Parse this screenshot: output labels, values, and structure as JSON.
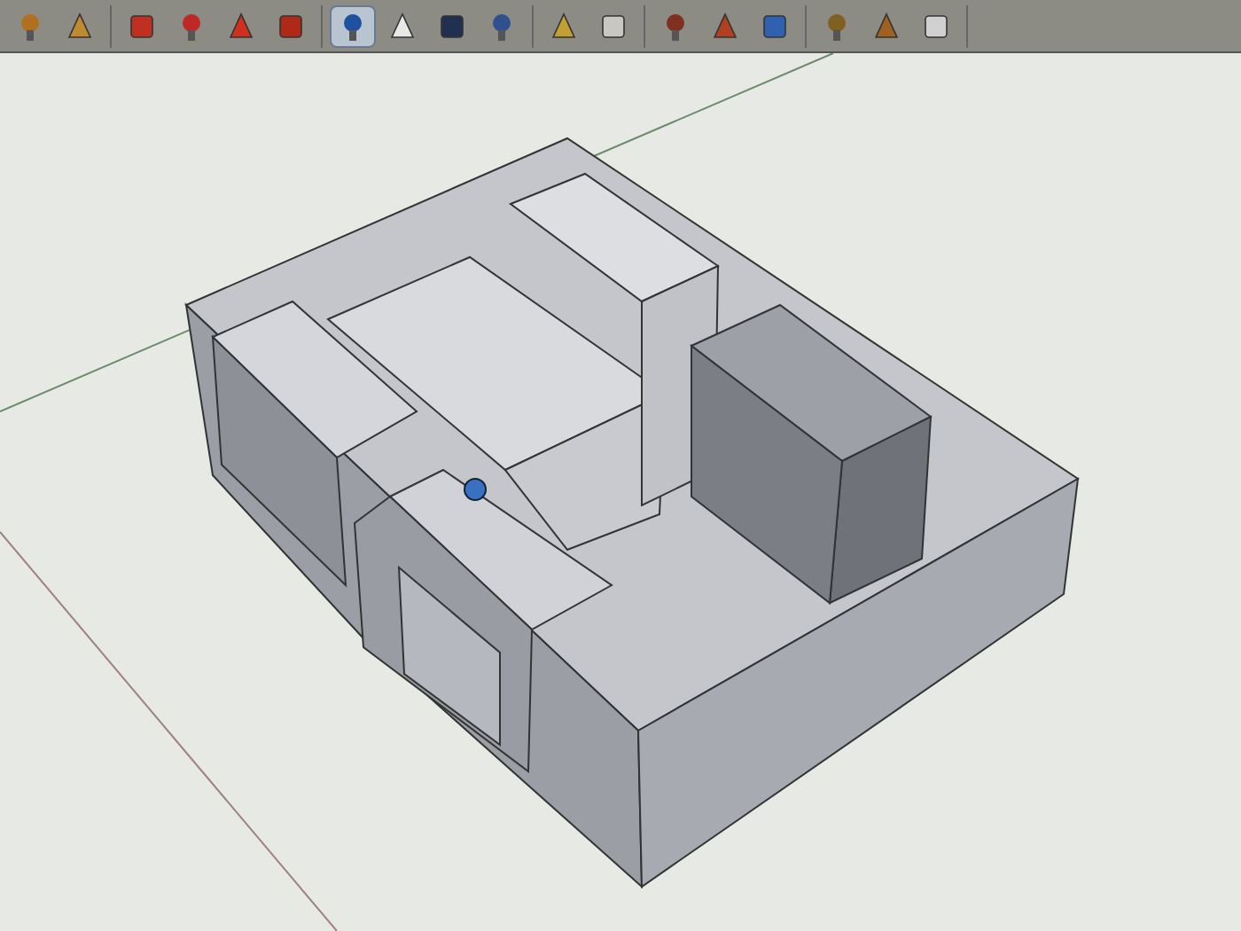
{
  "toolbar": {
    "groups": [
      {
        "tools": [
          {
            "selected": false
          },
          {
            "selected": false
          }
        ]
      },
      {
        "tools": [
          {
            "selected": false
          },
          {
            "selected": false
          },
          {
            "selected": false
          },
          {
            "selected": false
          }
        ]
      },
      {
        "tools": [
          {
            "selected": true
          },
          {
            "selected": false
          },
          {
            "selected": false
          },
          {
            "selected": false
          }
        ]
      },
      {
        "tools": [
          {
            "selected": false
          },
          {
            "selected": false
          }
        ]
      },
      {
        "tools": [
          {
            "selected": false
          },
          {
            "selected": false
          },
          {
            "selected": false
          }
        ]
      },
      {
        "tools": [
          {
            "selected": false
          },
          {
            "selected": false
          },
          {
            "selected": false
          }
        ]
      }
    ]
  }
}
